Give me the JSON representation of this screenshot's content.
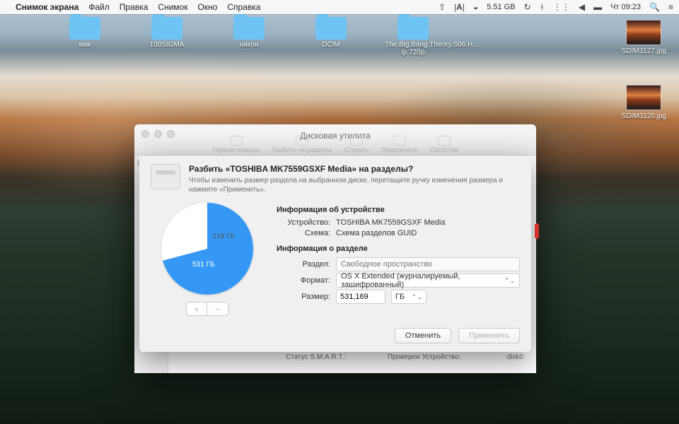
{
  "menubar": {
    "app": "Снимок экрана",
    "items": [
      "Файл",
      "Правка",
      "Снимок",
      "Окно",
      "Справка"
    ],
    "right": {
      "adobe": "A",
      "disk": "5.51 GB",
      "clock": "Чт 09:23"
    }
  },
  "desktop": {
    "folders": [
      "мак",
      "100SIGMA",
      "никон",
      "DCIM",
      "The.Big.Bang.Theory.S06.H…ip.720p"
    ],
    "thumbs": [
      "SDIM3127.jpg",
      "SDIM3120.jpg"
    ]
  },
  "du": {
    "title": "Дисковая утилита",
    "toolbar": [
      "Первая помощь",
      "Разбить на разделы",
      "Стереть",
      "Подключить",
      "Свойства"
    ],
    "sidebar_header": "Внутр",
    "status": {
      "left": "Статус S.M.A.R.T.:",
      "mid": "Проверен  Устройство:",
      "right": "disk0"
    }
  },
  "sheet": {
    "title": "Разбить «TOSHIBA MK7559GSXF Media» на разделы?",
    "subtitle": "Чтобы изменить размер раздела на выбранном диске, перетащите ручку изменения размера и нажмите «Применить».",
    "device_section": "Информация об устройстве",
    "device_label": "Устройство:",
    "device_value": "TOSHIBA MK7559GSXF Media",
    "scheme_label": "Схема:",
    "scheme_value": "Схема разделов GUID",
    "partition_section": "Информация о разделе",
    "partition_label": "Раздел:",
    "partition_placeholder": "Свободное пространство",
    "format_label": "Формат:",
    "format_value": "OS X Extended (журналируемый, зашифрованный)",
    "size_label": "Размер:",
    "size_value": "531,169",
    "size_unit": "ГБ",
    "pie": {
      "used": "531 ГБ",
      "free": "218 ГБ"
    },
    "add": "+",
    "remove": "−",
    "cancel": "Отменить",
    "apply": "Применить"
  },
  "chart_data": {
    "type": "pie",
    "title": "",
    "slices": [
      {
        "label": "531 ГБ",
        "value": 531,
        "color": "#3598f5"
      },
      {
        "label": "218 ГБ",
        "value": 218,
        "color": "#ffffff"
      }
    ]
  }
}
